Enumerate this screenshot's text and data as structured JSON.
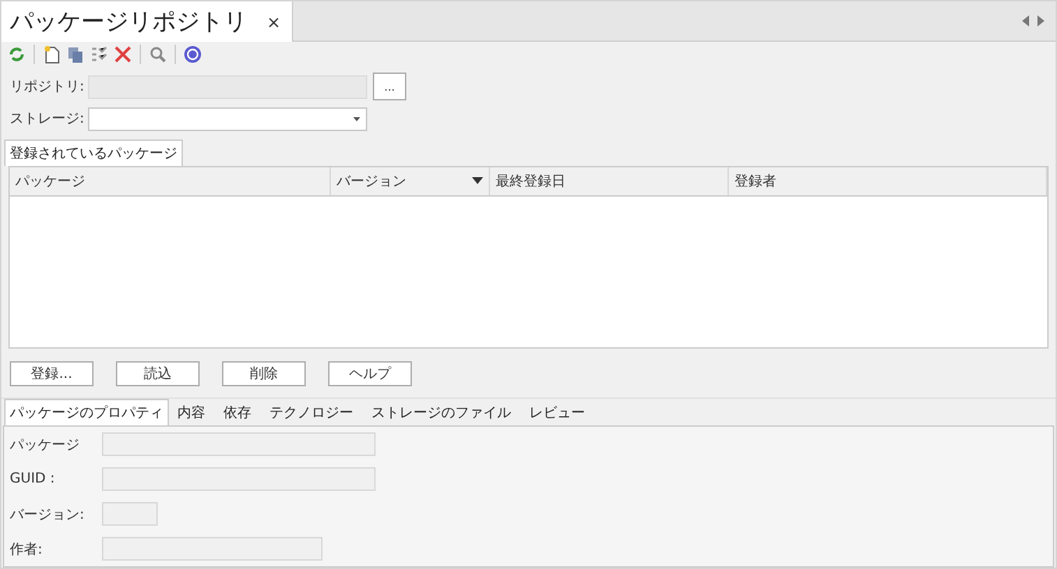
{
  "document_tab": {
    "title": "パッケージリポジトリ",
    "close": "×",
    "selected": true
  },
  "fields": [
    {
      "label": "リポジトリ:",
      "kind": "browse",
      "button": "..."
    },
    {
      "label": "ストレージ:",
      "kind": "dropdown"
    }
  ],
  "list_tabs": [
    {
      "label": "登録されているパッケージ",
      "selected": true
    }
  ],
  "table": {
    "columns": [
      {
        "label": "パッケージ",
        "sorted": false
      },
      {
        "label": "バージョン",
        "sorted": true
      },
      {
        "label": "最終登録日",
        "sorted": false
      },
      {
        "label": "登録者",
        "sorted": false
      }
    ]
  },
  "buttons": [
    "登録...",
    "読込",
    "削除",
    "ヘルプ"
  ],
  "property_tabs": [
    {
      "label": "パッケージのプロパティ",
      "selected": true
    },
    {
      "label": "内容",
      "selected": false
    },
    {
      "label": "依存",
      "selected": false
    },
    {
      "label": "テクノロジー",
      "selected": false
    },
    {
      "label": "ストレージのファイル",
      "selected": false
    },
    {
      "label": "レビュー",
      "selected": false
    }
  ],
  "properties": [
    {
      "label": "パッケージ"
    },
    {
      "label": "GUID :"
    },
    {
      "label": "バージョン:"
    },
    {
      "label": "作者:"
    }
  ]
}
